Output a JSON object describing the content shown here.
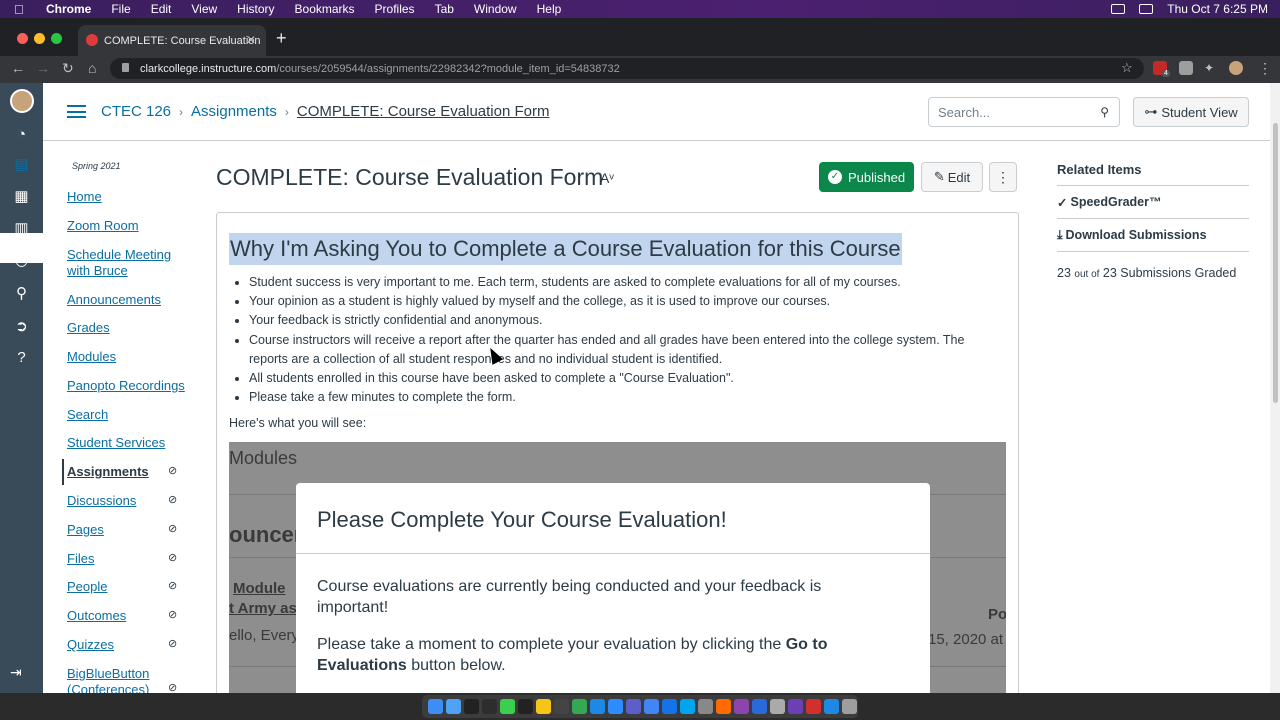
{
  "menubar": {
    "app": "Chrome",
    "items": [
      "File",
      "Edit",
      "View",
      "History",
      "Bookmarks",
      "Profiles",
      "Tab",
      "Window",
      "Help"
    ],
    "datetime": "Thu Oct 7  6:25 PM"
  },
  "browser": {
    "tab_title": "COMPLETE: Course Evaluation",
    "url_host": "clarkcollege.instructure.com",
    "url_path": "/courses/2059544/assignments/22982342?module_item_id=54838732",
    "extension_badge": "4"
  },
  "header": {
    "breadcrumbs": [
      "CTEC 126",
      "Assignments",
      "COMPLETE: Course Evaluation Form"
    ],
    "search_placeholder": "Search...",
    "student_view": "Student View"
  },
  "course_nav": {
    "term": "Spring 2021",
    "items": [
      {
        "label": "Home"
      },
      {
        "label": "Zoom Room"
      },
      {
        "label": "Schedule Meeting with Bruce"
      },
      {
        "label": "Announcements"
      },
      {
        "label": "Grades"
      },
      {
        "label": "Modules"
      },
      {
        "label": "Panopto Recordings"
      },
      {
        "label": "Search"
      },
      {
        "label": "Student Services"
      },
      {
        "label": "Assignments",
        "active": true,
        "hidden": true
      },
      {
        "label": "Discussions",
        "hidden": true
      },
      {
        "label": "Pages",
        "hidden": true
      },
      {
        "label": "Files",
        "hidden": true
      },
      {
        "label": "People",
        "hidden": true
      },
      {
        "label": "Outcomes",
        "hidden": true
      },
      {
        "label": "Quizzes",
        "hidden": true
      },
      {
        "label": "BigBlueButton (Conferences)",
        "hidden": true
      }
    ]
  },
  "assignment": {
    "title": "COMPLETE: Course Evaluation Form",
    "published_label": "Published",
    "edit_label": "Edit",
    "more_label": "⋮",
    "heading": "Why I'm Asking You to Complete a Course Evaluation for this Course",
    "bullets": [
      "Student success is very important to me. Each term, students are asked to complete evaluations for all of my courses.",
      "Your opinion as a student is highly valued by myself and the college, as it is used to improve our courses.",
      "Your feedback is strictly confidential and anonymous.",
      "Course instructors will receive a report after the quarter has ended and all grades have been entered into the college system. The reports are a collection of all student responses and no individual student is identified.",
      "All students enrolled in this course have been asked to complete a \"Course Evaluation\".",
      "Please take a few minutes to complete the form."
    ],
    "see_line": "Here's what you will see:"
  },
  "screenshot_bg": {
    "modules": "Modules",
    "announce": "ouncen",
    "module_row": "Module",
    "army": "t Army as",
    "hello": "ello, Every",
    "po": "Po",
    "date": "15, 2020 at"
  },
  "modal": {
    "title": "Please Complete Your Course Evaluation!",
    "p1": "Course evaluations are currently being conducted and your feedback is important!",
    "p2_pre": "Please take a moment to complete your evaluation by clicking the ",
    "p2_bold": "Go to Evaluations",
    "p2_post": " button below."
  },
  "related": {
    "heading": "Related Items",
    "speedgrader": "SpeedGrader™",
    "download": "Download Submissions",
    "graded_count": "23",
    "graded_outof": "out of",
    "graded_total": "23 Submissions Graded"
  },
  "colors": {
    "link": "#0b6ea1",
    "published": "#0b874b",
    "global_nav": "#394b58",
    "highlight": "#c2d5ef"
  }
}
